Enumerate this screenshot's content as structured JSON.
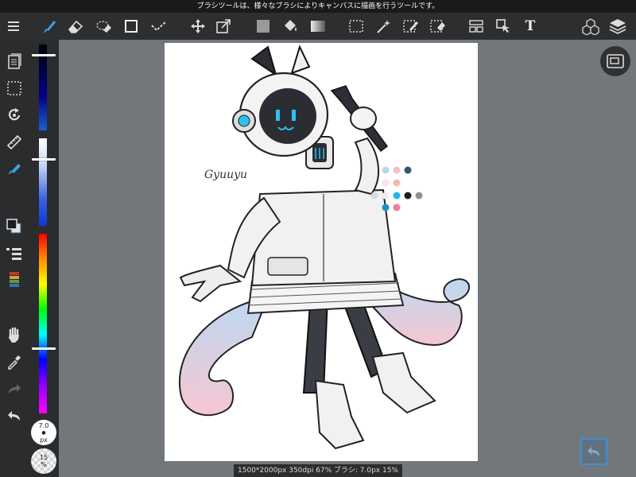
{
  "status_bar": {
    "message": "ブラシツールは、様々なブラシによりキャンバスに描画を行うツールです。"
  },
  "toolbar": {
    "tools": [
      "menu-icon",
      "brush-icon",
      "eraser-icon",
      "lasso-eraser-icon",
      "rectangle-icon",
      "check-select-icon",
      "move-icon",
      "transform-icon",
      "fill-color-icon",
      "bucket-icon",
      "gradient-icon",
      "select-rect-icon",
      "magic-wand-icon",
      "select-pen-icon",
      "select-eraser-icon",
      "layout-icon",
      "pointer-icon",
      "text-icon"
    ],
    "text_tool_label": "T",
    "right_icons": [
      "materials-icon",
      "layers-icon"
    ]
  },
  "colors": {
    "accent": "#3fa3e8",
    "toolbar_bg": "#2d2e30",
    "workspace_bg": "#72777c"
  },
  "color_panel": {
    "brush_size_value": "7.0",
    "brush_size_unit": "px",
    "opacity_value": "15",
    "opacity_unit": "%"
  },
  "left_tools": [
    "pages-icon",
    "selection-icon",
    "rotate-icon",
    "ruler-icon",
    "fill-icon",
    "color-swatch-icon",
    "layer-list-icon",
    "palette-icon",
    "hand-icon",
    "eyedropper-icon",
    "redo-icon",
    "undo-icon"
  ],
  "canvas": {
    "signature": "Gyuuyu",
    "swatches": [
      "#b7d6ef",
      "#f3c0c9",
      "#34576a",
      "#fbe4e2",
      "#f2bcac",
      "#d7dadb",
      "#edeeee",
      "#1fb6ee",
      "#1b1d22",
      "#8d939a",
      "#1e8fd0",
      "#f07da0"
    ]
  },
  "info_bar": {
    "text": "1500*2000px 350dpi 67% ブラシ: 7.0px 15%"
  }
}
